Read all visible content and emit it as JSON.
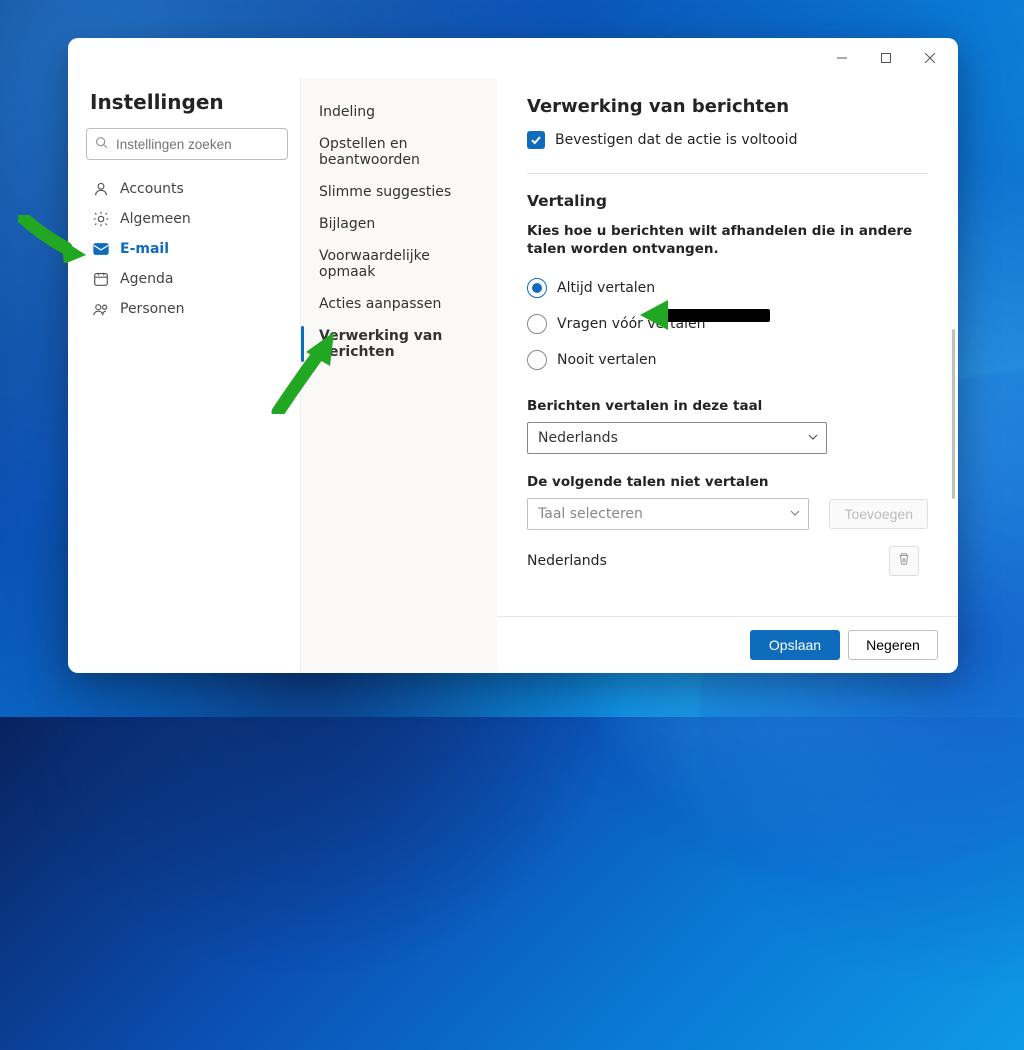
{
  "titlebar": {},
  "sidebar": {
    "title": "Instellingen",
    "search_placeholder": "Instellingen zoeken",
    "items": [
      {
        "label": "Accounts"
      },
      {
        "label": "Algemeen"
      },
      {
        "label": "E-mail"
      },
      {
        "label": "Agenda"
      },
      {
        "label": "Personen"
      }
    ]
  },
  "middle": {
    "items": [
      {
        "label": "Indeling"
      },
      {
        "label": "Opstellen en beantwoorden"
      },
      {
        "label": "Slimme suggesties"
      },
      {
        "label": "Bijlagen"
      },
      {
        "label": "Voorwaardelijke opmaak"
      },
      {
        "label": "Acties aanpassen"
      },
      {
        "label": "Verwerking van berichten"
      }
    ]
  },
  "content": {
    "title": "Verwerking van berichten",
    "checkbox_label": "Bevestigen dat de actie is voltooid",
    "translate": {
      "title": "Vertaling",
      "description": "Kies hoe u berichten wilt afhandelen die in andere talen worden ontvangen.",
      "options": [
        "Altijd vertalen",
        "Vragen vóór vertalen",
        "Nooit vertalen"
      ],
      "lang_label": "Berichten vertalen in deze taal",
      "lang_value": "Nederlands",
      "exclude_label": "De volgende talen niet vertalen",
      "select_placeholder": "Taal selecteren",
      "add_button": "Toevoegen",
      "excluded_lang": "Nederlands"
    }
  },
  "footer": {
    "save": "Opslaan",
    "cancel": "Negeren"
  }
}
